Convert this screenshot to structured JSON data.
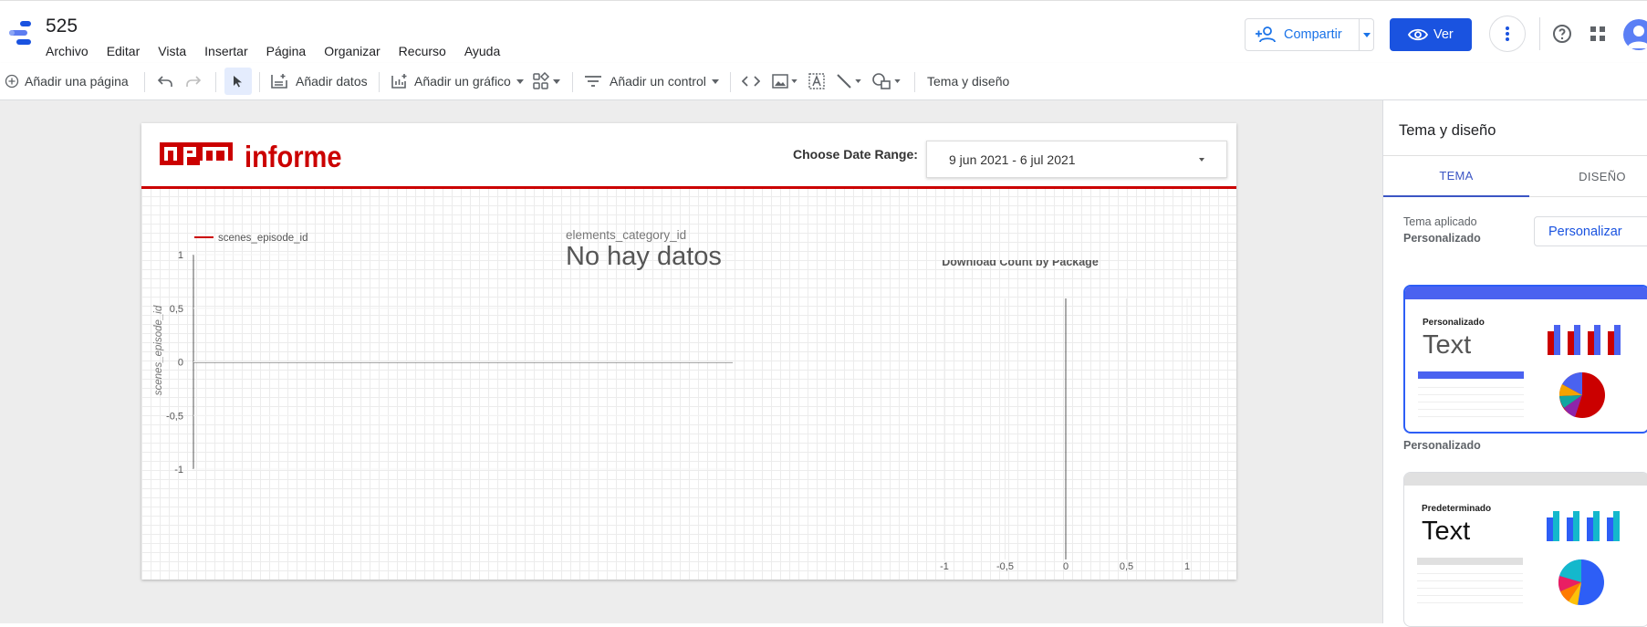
{
  "header": {
    "doc_title": "525",
    "menu": [
      "Archivo",
      "Editar",
      "Vista",
      "Insertar",
      "Página",
      "Organizar",
      "Recurso",
      "Ayuda"
    ],
    "share_label": "Compartir",
    "view_label": "Ver"
  },
  "toolbar": {
    "add_page": "Añadir una página",
    "add_data": "Añadir datos",
    "add_chart": "Añadir un gráfico",
    "add_control": "Añadir un control",
    "theme_layout": "Tema y diseño"
  },
  "report": {
    "title": "informe",
    "logo_text": "npm",
    "date_label": "Choose Date Range:",
    "date_range": "9 jun 2021 - 6 jul 2021",
    "no_data_field": "elements_category_id",
    "no_data_text": "No hay datos"
  },
  "colors": {
    "brand_red": "#cb0000",
    "accent_blue": "#1a53e0"
  },
  "panel": {
    "title": "Tema y diseño",
    "tab_theme": "TEMA",
    "tab_layout": "DISEÑO",
    "applied_label": "Tema aplicado",
    "applied_value": "Personalizado",
    "customize_label": "Personalizar",
    "card_custom_name": "Personalizado",
    "card_custom_text": "Text",
    "card_custom_caption": "Personalizado",
    "card_default_name": "Predeterminado",
    "card_default_text": "Text"
  },
  "chart_data": [
    {
      "type": "line",
      "title": "",
      "series": [
        {
          "name": "scenes_episode_id",
          "values": [
            0,
            0
          ]
        }
      ],
      "ylabel": "scenes_episode_id",
      "xlabel": "",
      "yticks": [
        "1",
        "0,5",
        "0",
        "-0,5",
        "-1"
      ],
      "ylim": [
        -1,
        1
      ],
      "legend": "top-left",
      "series_color": "#cb0000"
    },
    {
      "type": "bar",
      "title": "Download Count by Package",
      "categories": [],
      "values": [],
      "xticks": [
        "-1",
        "-0,5",
        "0",
        "0,5",
        "1"
      ],
      "xlim": [
        -1,
        1
      ]
    }
  ]
}
